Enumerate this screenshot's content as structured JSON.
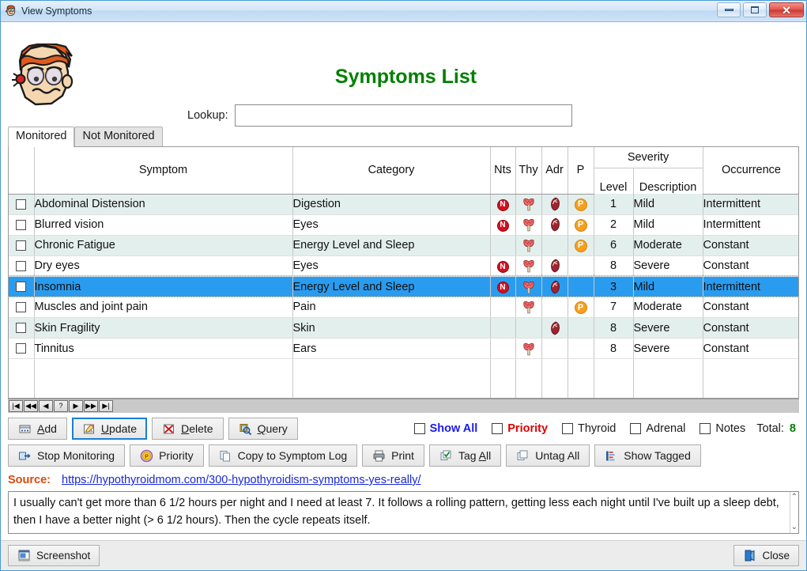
{
  "window": {
    "title": "View Symptoms",
    "icon": "sick-face-icon",
    "minimize_label": "Minimize",
    "restore_label": "Restore",
    "close_label": "Close"
  },
  "header": {
    "page_title": "Symptoms List",
    "lookup_label": "Lookup:",
    "lookup_value": "",
    "lookup_placeholder": ""
  },
  "tabs": [
    {
      "label": "Monitored",
      "active": true
    },
    {
      "label": "Not Monitored",
      "active": false
    }
  ],
  "grid": {
    "columns": {
      "check": "",
      "symptom": "Symptom",
      "category": "Category",
      "nts": "Nts",
      "thy": "Thy",
      "adr": "Adr",
      "p": "P",
      "severity": "Severity",
      "level": "Level",
      "description": "Description",
      "occurrence": "Occurrence"
    },
    "rows": [
      {
        "checked": false,
        "symptom": "Abdominal Distension",
        "category": "Digestion",
        "nts": true,
        "thy": true,
        "adr": true,
        "p": true,
        "level": "1",
        "description": "Mild",
        "occurrence": "Intermittent",
        "selected": false
      },
      {
        "checked": false,
        "symptom": "Blurred vision",
        "category": "Eyes",
        "nts": true,
        "thy": true,
        "adr": true,
        "p": true,
        "level": "2",
        "description": "Mild",
        "occurrence": "Intermittent",
        "selected": false
      },
      {
        "checked": false,
        "symptom": "Chronic Fatigue",
        "category": "Energy Level and Sleep",
        "nts": false,
        "thy": true,
        "adr": false,
        "p": true,
        "level": "6",
        "description": "Moderate",
        "occurrence": "Constant",
        "selected": false
      },
      {
        "checked": false,
        "symptom": "Dry eyes",
        "category": "Eyes",
        "nts": true,
        "thy": true,
        "adr": true,
        "p": false,
        "level": "8",
        "description": "Severe",
        "occurrence": "Constant",
        "selected": false
      },
      {
        "checked": false,
        "symptom": "Insomnia",
        "category": "Energy Level and Sleep",
        "nts": true,
        "thy": true,
        "adr": true,
        "p": false,
        "level": "3",
        "description": "Mild",
        "occurrence": "Intermittent",
        "selected": true
      },
      {
        "checked": false,
        "symptom": "Muscles and joint pain",
        "category": "Pain",
        "nts": false,
        "thy": true,
        "adr": false,
        "p": true,
        "level": "7",
        "description": "Moderate",
        "occurrence": "Constant",
        "selected": false
      },
      {
        "checked": false,
        "symptom": "Skin Fragility",
        "category": "Skin",
        "nts": false,
        "thy": false,
        "adr": true,
        "p": false,
        "level": "8",
        "description": "Severe",
        "occurrence": "Constant",
        "selected": false
      },
      {
        "checked": false,
        "symptom": "Tinnitus",
        "category": "Ears",
        "nts": false,
        "thy": true,
        "adr": false,
        "p": false,
        "level": "8",
        "description": "Severe",
        "occurrence": "Constant",
        "selected": false
      }
    ]
  },
  "navigator": {
    "first": "|◀",
    "prev_page": "◀◀",
    "prev": "◀",
    "mark": "?",
    "next": "▶",
    "next_page": "▶▶",
    "last": "▶|"
  },
  "toolbar_row1": {
    "add": "Add",
    "add_accel": "A",
    "update": "Update",
    "update_accel": "U",
    "delete": "Delete",
    "delete_accel": "D",
    "query": "Query",
    "query_accel": "Q"
  },
  "filters": {
    "show_all": "Show All",
    "priority": "Priority",
    "thyroid": "Thyroid",
    "adrenal": "Adrenal",
    "notes": "Notes",
    "total_label": "Total:",
    "total_value": "8",
    "show_all_checked": false,
    "priority_checked": false,
    "thyroid_checked": false,
    "adrenal_checked": false,
    "notes_checked": false,
    "show_all_color": "#1a1af0",
    "priority_color": "#e00000",
    "total_color": "#008000"
  },
  "toolbar_row2": {
    "stop_monitoring": "Stop Monitoring",
    "priority": "Priority",
    "copy_to_log": "Copy to Symptom Log",
    "print": "Print",
    "tag_all": "Tag All",
    "tag_all_accel": "A",
    "untag_all": "Untag All",
    "untag_all_accel": "g",
    "show_tagged": "Show Tagged"
  },
  "source": {
    "label": "Source:",
    "url": "https://hypothyroidmom.com/300-hypothyroidism-symptoms-yes-really/"
  },
  "notes_box": {
    "text": "I usually can't get more than 6 1/2 hours per night and I need at least 7. It follows a rolling pattern, getting less each night until I've built up a sleep debt, then I have a better night (> 6 1/2 hours). Then the cycle repeats itself.",
    "scroll_up": "⌃",
    "scroll_down": "⌄"
  },
  "bottom": {
    "screenshot": "Screenshot",
    "close": "Close"
  }
}
